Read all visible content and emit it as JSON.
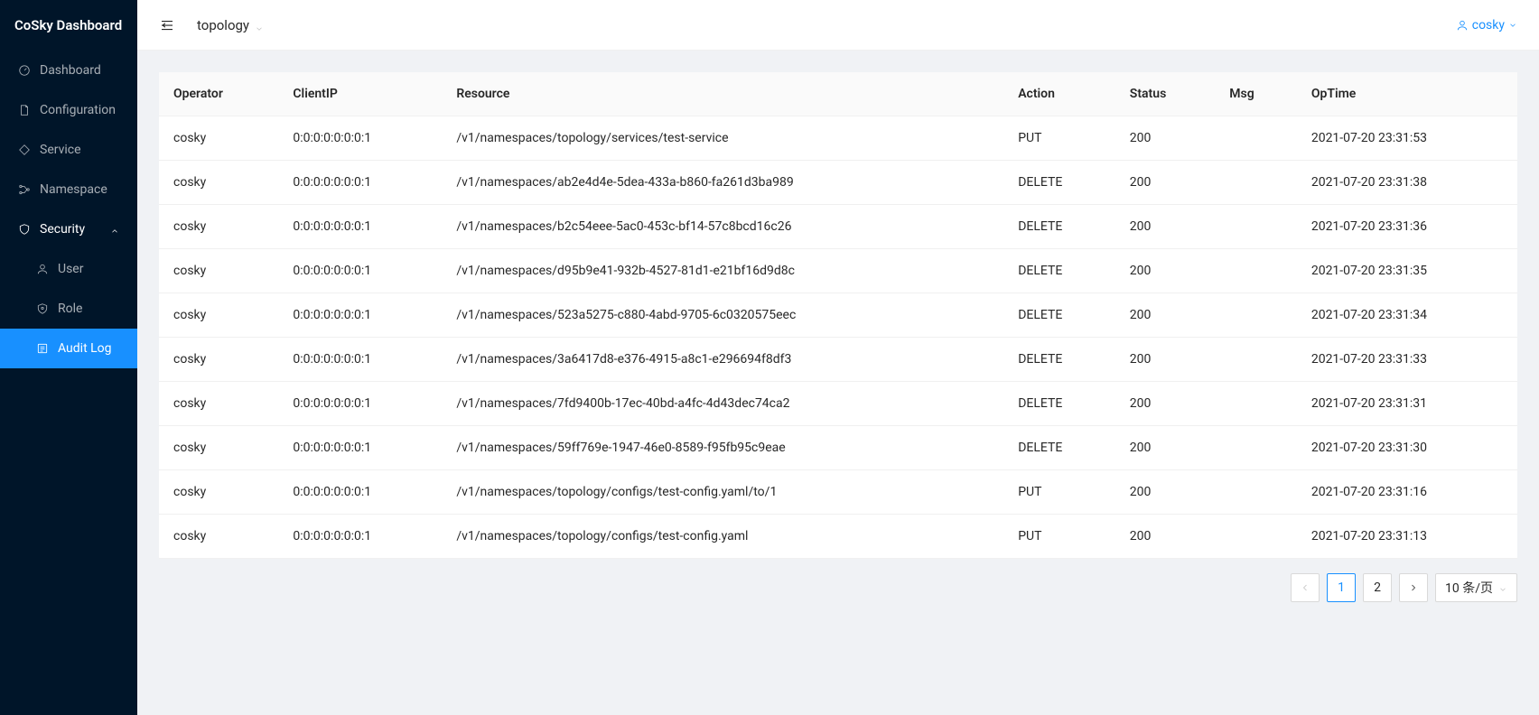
{
  "brand": "CoSky Dashboard",
  "sidebar": {
    "items": [
      {
        "label": "Dashboard",
        "icon": "dashboard-icon"
      },
      {
        "label": "Configuration",
        "icon": "file-icon"
      },
      {
        "label": "Service",
        "icon": "tag-icon"
      },
      {
        "label": "Namespace",
        "icon": "nodes-icon"
      },
      {
        "label": "Security",
        "icon": "shield-icon",
        "expanded": true,
        "children": [
          {
            "label": "User",
            "icon": "user-icon"
          },
          {
            "label": "Role",
            "icon": "role-icon"
          },
          {
            "label": "Audit Log",
            "icon": "audit-icon",
            "active": true
          }
        ]
      }
    ]
  },
  "header": {
    "breadcrumb": "topology",
    "user": "cosky"
  },
  "table": {
    "columns": [
      "Operator",
      "ClientIP",
      "Resource",
      "Action",
      "Status",
      "Msg",
      "OpTime"
    ],
    "rows": [
      {
        "operator": "cosky",
        "clientIp": "0:0:0:0:0:0:0:1",
        "resource": "/v1/namespaces/topology/services/test-service",
        "action": "PUT",
        "status": "200",
        "msg": "",
        "opTime": "2021-07-20 23:31:53"
      },
      {
        "operator": "cosky",
        "clientIp": "0:0:0:0:0:0:0:1",
        "resource": "/v1/namespaces/ab2e4d4e-5dea-433a-b860-fa261d3ba989",
        "action": "DELETE",
        "status": "200",
        "msg": "",
        "opTime": "2021-07-20 23:31:38"
      },
      {
        "operator": "cosky",
        "clientIp": "0:0:0:0:0:0:0:1",
        "resource": "/v1/namespaces/b2c54eee-5ac0-453c-bf14-57c8bcd16c26",
        "action": "DELETE",
        "status": "200",
        "msg": "",
        "opTime": "2021-07-20 23:31:36"
      },
      {
        "operator": "cosky",
        "clientIp": "0:0:0:0:0:0:0:1",
        "resource": "/v1/namespaces/d95b9e41-932b-4527-81d1-e21bf16d9d8c",
        "action": "DELETE",
        "status": "200",
        "msg": "",
        "opTime": "2021-07-20 23:31:35"
      },
      {
        "operator": "cosky",
        "clientIp": "0:0:0:0:0:0:0:1",
        "resource": "/v1/namespaces/523a5275-c880-4abd-9705-6c0320575eec",
        "action": "DELETE",
        "status": "200",
        "msg": "",
        "opTime": "2021-07-20 23:31:34"
      },
      {
        "operator": "cosky",
        "clientIp": "0:0:0:0:0:0:0:1",
        "resource": "/v1/namespaces/3a6417d8-e376-4915-a8c1-e296694f8df3",
        "action": "DELETE",
        "status": "200",
        "msg": "",
        "opTime": "2021-07-20 23:31:33"
      },
      {
        "operator": "cosky",
        "clientIp": "0:0:0:0:0:0:0:1",
        "resource": "/v1/namespaces/7fd9400b-17ec-40bd-a4fc-4d43dec74ca2",
        "action": "DELETE",
        "status": "200",
        "msg": "",
        "opTime": "2021-07-20 23:31:31"
      },
      {
        "operator": "cosky",
        "clientIp": "0:0:0:0:0:0:0:1",
        "resource": "/v1/namespaces/59ff769e-1947-46e0-8589-f95fb95c9eae",
        "action": "DELETE",
        "status": "200",
        "msg": "",
        "opTime": "2021-07-20 23:31:30"
      },
      {
        "operator": "cosky",
        "clientIp": "0:0:0:0:0:0:0:1",
        "resource": "/v1/namespaces/topology/configs/test-config.yaml/to/1",
        "action": "PUT",
        "status": "200",
        "msg": "",
        "opTime": "2021-07-20 23:31:16"
      },
      {
        "operator": "cosky",
        "clientIp": "0:0:0:0:0:0:0:1",
        "resource": "/v1/namespaces/topology/configs/test-config.yaml",
        "action": "PUT",
        "status": "200",
        "msg": "",
        "opTime": "2021-07-20 23:31:13"
      }
    ]
  },
  "pagination": {
    "pages": [
      "1",
      "2"
    ],
    "current": "1",
    "pageSize": "10 条/页"
  }
}
